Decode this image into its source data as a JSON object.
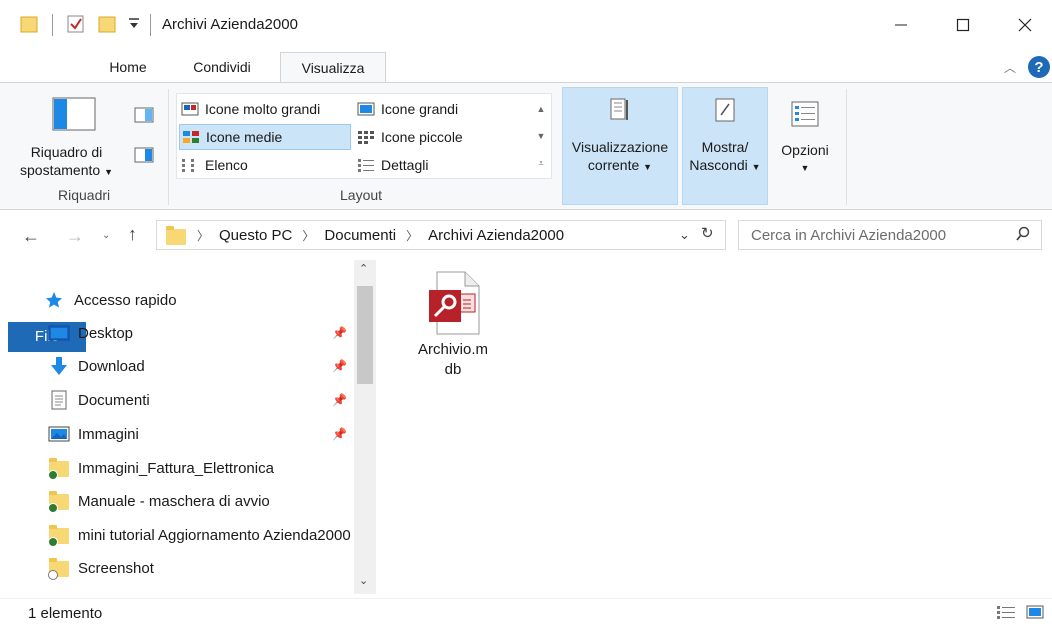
{
  "window": {
    "title": "Archivi Azienda2000",
    "minimize_icon": "minimize-icon",
    "maximize_icon": "maximize-icon",
    "close_icon": "close-icon"
  },
  "tabs": [
    {
      "label": "File"
    },
    {
      "label": "Home"
    },
    {
      "label": "Condividi"
    },
    {
      "label": "Visualizza"
    }
  ],
  "ribbon": {
    "riquadri": {
      "button_label_line1": "Riquadro di",
      "button_label_line2": "spostamento",
      "group_label": "Riquadri"
    },
    "layout": {
      "group_label": "Layout",
      "items": [
        {
          "label": "Icone molto grandi"
        },
        {
          "label": "Icone grandi"
        },
        {
          "label": "Icone medie"
        },
        {
          "label": "Icone piccole"
        },
        {
          "label": "Elenco"
        },
        {
          "label": "Dettagli"
        }
      ],
      "selected": "Icone medie"
    },
    "vista_corrente": {
      "line1": "Visualizzazione",
      "line2": "corrente"
    },
    "mostra": {
      "line1": "Mostra/",
      "line2": "Nascondi"
    },
    "opzioni": {
      "label": "Opzioni"
    }
  },
  "address": {
    "breadcrumb": [
      "Questo PC",
      "Documenti",
      "Archivi Azienda2000"
    ],
    "search_placeholder": "Cerca in Archivi Azienda2000"
  },
  "nav": {
    "quick_access": "Accesso rapido",
    "items": [
      {
        "label": "Desktop",
        "pinned": true
      },
      {
        "label": "Download",
        "pinned": true
      },
      {
        "label": "Documenti",
        "pinned": true
      },
      {
        "label": "Immagini",
        "pinned": true
      },
      {
        "label": "Immagini_Fattura_Elettronica",
        "pinned": false
      },
      {
        "label": "Manuale - maschera di avvio",
        "pinned": false
      },
      {
        "label": "mini tutorial Aggiornamento Azienda2000",
        "pinned": false
      },
      {
        "label": "Screenshot",
        "pinned": false
      }
    ]
  },
  "files": [
    {
      "name_line1": "Archivio.m",
      "name_line2": "db"
    }
  ],
  "status": {
    "count": "1 elemento"
  },
  "colors": {
    "accent": "#1e6ab7",
    "selection": "#cce4f7",
    "access_red": "#b7222a"
  }
}
